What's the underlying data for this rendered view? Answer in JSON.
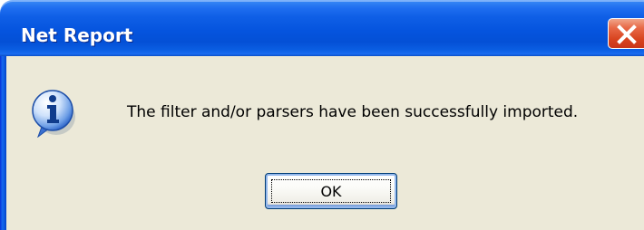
{
  "window": {
    "title": "Net Report",
    "close_icon": "close-icon"
  },
  "message": {
    "icon": "info-icon",
    "text": "The filter and/or parsers have been successfully imported."
  },
  "buttons": {
    "ok_label": "OK"
  },
  "colors": {
    "titlebar": "#0554de",
    "close_button": "#e0502c",
    "client_background": "#ece9d8",
    "info_icon": "#2a6fd6"
  }
}
